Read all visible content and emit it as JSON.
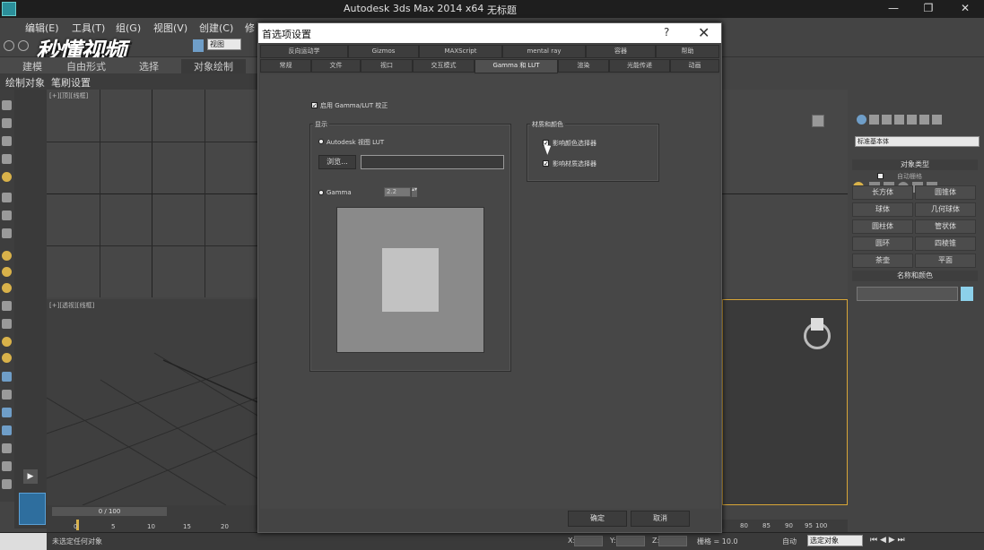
{
  "window": {
    "title": "Autodesk 3ds Max  2014 x64",
    "doc_title": "无标题",
    "minimize": "—",
    "restore": "❐",
    "close": "✕"
  },
  "menu": {
    "items": [
      "编辑(E)",
      "工具(T)",
      "组(G)",
      "视图(V)",
      "创建(C)",
      "修"
    ]
  },
  "watermark": "秒懂视频",
  "toolbar": {
    "view_dropdown": "视图",
    "ribbon_tabs": [
      "建模",
      "自由形式",
      "选择",
      "对象绘制"
    ],
    "paint_tabs": [
      "绘制对象",
      "笔刷设置"
    ]
  },
  "viewports": {
    "top_label": "[+][顶][线框]",
    "persp_label": "[+][透视][线框]"
  },
  "timeline": {
    "slider": "0 / 100",
    "ticks": [
      "0",
      "5",
      "10",
      "15",
      "20"
    ],
    "right_ticks": [
      "80",
      "85",
      "90",
      "95",
      "100"
    ]
  },
  "status": {
    "message": "未选定任何对象",
    "x_label": "X:",
    "y_label": "Y:",
    "z_label": "Z:",
    "grid": "栅格 = 10.0",
    "auto": "自动",
    "selection": "选定对象"
  },
  "command_panel": {
    "dropdown": "标准基本体",
    "object_type_header": "对象类型",
    "autogrid": "自动栅格",
    "buttons": [
      "长方体",
      "圆锥体",
      "球体",
      "几何球体",
      "圆柱体",
      "管状体",
      "圆环",
      "四棱锥",
      "茶壶",
      "平面"
    ],
    "name_color_header": "名称和颜色"
  },
  "dialog": {
    "title": "首选项设置",
    "help": "?",
    "close": "✕",
    "tabs_row1": [
      "反向运动学",
      "Gizmos",
      "MAXScript",
      "mental ray",
      "容器",
      "帮助"
    ],
    "tabs_row2": [
      "常规",
      "文件",
      "视口",
      "交互模式",
      "Gamma 和 LUT",
      "渲染",
      "光能传递",
      "动画"
    ],
    "enable_gamma": "启用 Gamma/LUT 校正",
    "display_group": "显示",
    "lut_radio": "Autodesk 视图 LUT",
    "browse_button": "浏览...",
    "gamma_radio": "Gamma",
    "gamma_value": "2.2",
    "material_group": "材质和颜色",
    "affect_color_selector": "影响颜色选择器",
    "affect_material_selector": "影响材质选择器",
    "ok_button": "确定",
    "cancel_button": "取消"
  }
}
